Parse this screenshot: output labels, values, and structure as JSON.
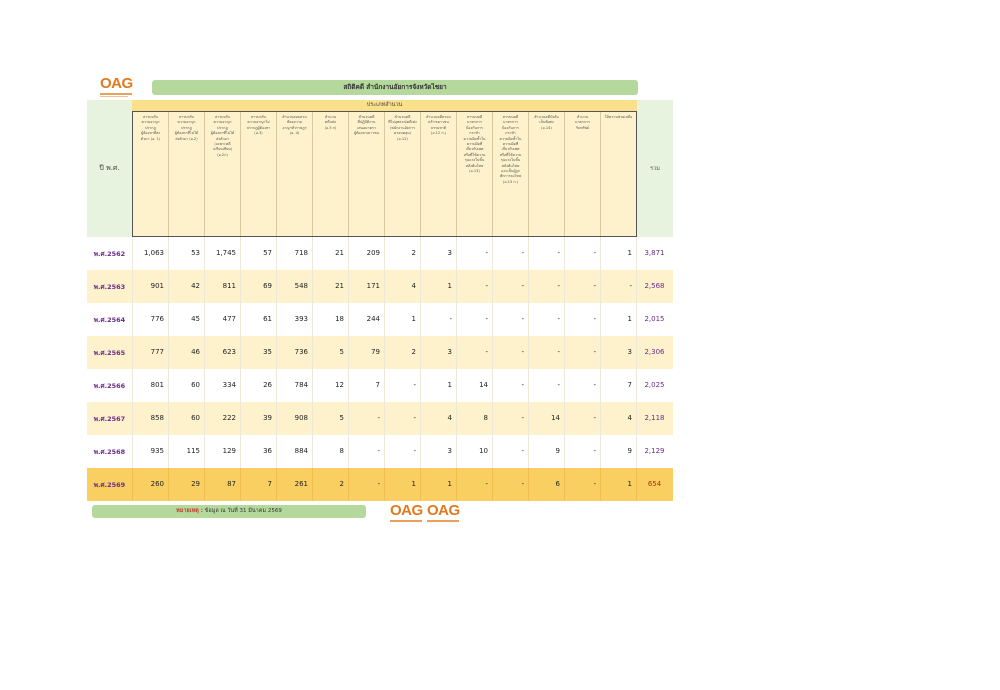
{
  "logo": {
    "text": "OAG"
  },
  "title": "สถิติคดี สำนักงานอัยการจังหวัดไชยา",
  "header": {
    "year_label": "ปี พ.ศ.",
    "group_label": "ประเภทสำนวน",
    "total_label": "รวม",
    "categories": [
      "สารบบรับ\nความอาญา\nปรากฎ\nผู้ต้องหาที่ส่ง\nตัวมา (อ. 1)",
      "สารบบรับ\nความอาญา\nปรากฎ\nผู้ต้องหาที่ไม่ได้\nส่งตัวมา (อ.2)",
      "สารบบรับ\nความอาญา\nปรากฎ\nผู้ต้องหาที่ไม่ได้\nส่งตัวมา\n(เฉพาะคดี\nเปรียบเทียบ)\n(อ.2ก)",
      "สารบบรับ\nความอาญาไม่\nปรากฎผู้ต้องหา\n(อ.3)",
      "สำนวนสอบสวน\nฟ้องความ\nอาญาทั่วราษฎร\n(อ. 4)",
      "สำนวน\nคดีแพ่ง\n(อ.5 ก)",
      "สำนวนคดี\nที่ปฏิบัติงาน\nเสนอมาตรา\nผู้ต้องหาเยาวชน",
      "สำนวนคดี\nที่ไม่อุทธรณ์คดีเพ่ง\n(พนักงานอัยการ\nครอบคลุม)\n(อ.12)",
      "สำนวนคดีครอบ\nครัวฯเยาวชน\nธรรมชาติ\n(อ.12 ก.)",
      "สารบบคดี\nมาตรการ\nป้องกันการ\nกระทำ\nความผิดซ้ำใน\nความผิดที่\nเกี่ยวกับเพศ\nหรือที่ใช้ความ\nรุนแรงในชั้น\nหลังพ้นโทษ\n(อ.13)",
      "สารบบคดี\nมาตรการ\nป้องกันการ\nกระทำ\nความผิดซ้ำใน\nความผิดที่\nเกี่ยวกับเพศ\nหรือที่ใช้ความ\nรุนแรงในชั้น\nหลังพ้นโทษ\nและเป็นผู้ถูก\nพักการลงโทษ\n(อ.13 ก.)",
      "สำนวนคดีบังคับ\nเป็นพิเศษ\n(อ.14)",
      "สำนวน\nมาตรการ\nรับทรัพย์",
      "ให้ความช่วยเหลือ"
    ]
  },
  "rows": [
    {
      "year": "พ.ศ.2562",
      "values": [
        "1,063",
        "53",
        "1,745",
        "57",
        "718",
        "21",
        "209",
        "2",
        "3",
        "-",
        "-",
        "-",
        "-",
        "1"
      ],
      "total": "3,871"
    },
    {
      "year": "พ.ศ.2563",
      "values": [
        "901",
        "42",
        "811",
        "69",
        "548",
        "21",
        "171",
        "4",
        "1",
        "-",
        "-",
        "-",
        "-",
        "-"
      ],
      "total": "2,568"
    },
    {
      "year": "พ.ศ.2564",
      "values": [
        "776",
        "45",
        "477",
        "61",
        "393",
        "18",
        "244",
        "1",
        "-",
        "-",
        "-",
        "-",
        "-",
        "1"
      ],
      "total": "2,015"
    },
    {
      "year": "พ.ศ.2565",
      "values": [
        "777",
        "46",
        "623",
        "35",
        "736",
        "5",
        "79",
        "2",
        "3",
        "-",
        "-",
        "-",
        "-",
        "3"
      ],
      "total": "2,306"
    },
    {
      "year": "พ.ศ.2566",
      "values": [
        "801",
        "60",
        "334",
        "26",
        "784",
        "12",
        "7",
        "-",
        "1",
        "14",
        "-",
        "-",
        "-",
        "7"
      ],
      "total": "2,025"
    },
    {
      "year": "พ.ศ.2567",
      "values": [
        "858",
        "60",
        "222",
        "39",
        "908",
        "5",
        "-",
        "-",
        "4",
        "8",
        "-",
        "14",
        "-",
        "4"
      ],
      "total": "2,118"
    },
    {
      "year": "พ.ศ.2568",
      "values": [
        "935",
        "115",
        "129",
        "36",
        "884",
        "8",
        "-",
        "-",
        "3",
        "10",
        "-",
        "9",
        "-",
        "9"
      ],
      "total": "2,129"
    },
    {
      "year": "พ.ศ.2569",
      "values": [
        "260",
        "29",
        "87",
        "7",
        "261",
        "2",
        "-",
        "1",
        "1",
        "-",
        "-",
        "6",
        "-",
        "1"
      ],
      "total": "654"
    }
  ],
  "note": {
    "label": "หมายเหตุ :",
    "text": "ข้อมูล ณ วันที่ 31 มีนาคม  2569"
  },
  "colors": {
    "header_green": "#b5d99c",
    "row_shade": "#fdf2cc",
    "highlight": "#f9cf62",
    "year_text": "#6b2a8a"
  }
}
